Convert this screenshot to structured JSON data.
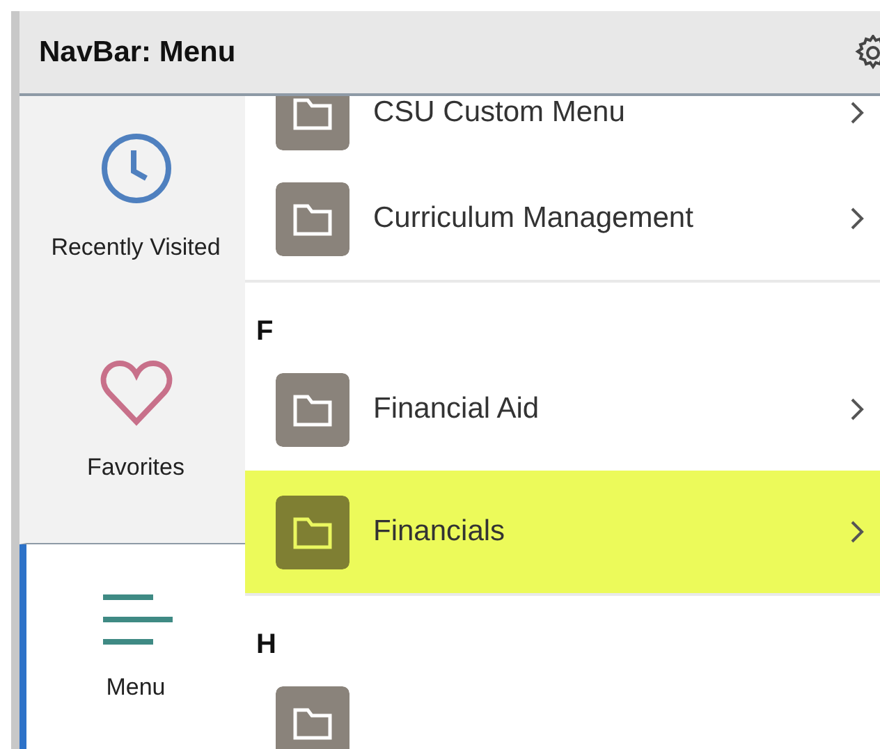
{
  "header": {
    "title": "NavBar: Menu"
  },
  "sidebar": {
    "items": [
      {
        "label": "Recently Visited",
        "kind": "clock",
        "selected": false
      },
      {
        "label": "Favorites",
        "kind": "heart",
        "selected": false
      },
      {
        "label": "Menu",
        "kind": "menu",
        "selected": true
      }
    ]
  },
  "menu": {
    "sections": [
      {
        "items": [
          {
            "label": "CSU Custom Menu",
            "highlighted": false
          },
          {
            "label": "Curriculum Management",
            "highlighted": false
          }
        ]
      },
      {
        "letter": "F",
        "items": [
          {
            "label": "Financial Aid",
            "highlighted": false
          },
          {
            "label": "Financials",
            "highlighted": true
          }
        ]
      },
      {
        "letter": "H",
        "items": [
          {
            "highlighted": false
          }
        ]
      }
    ]
  }
}
